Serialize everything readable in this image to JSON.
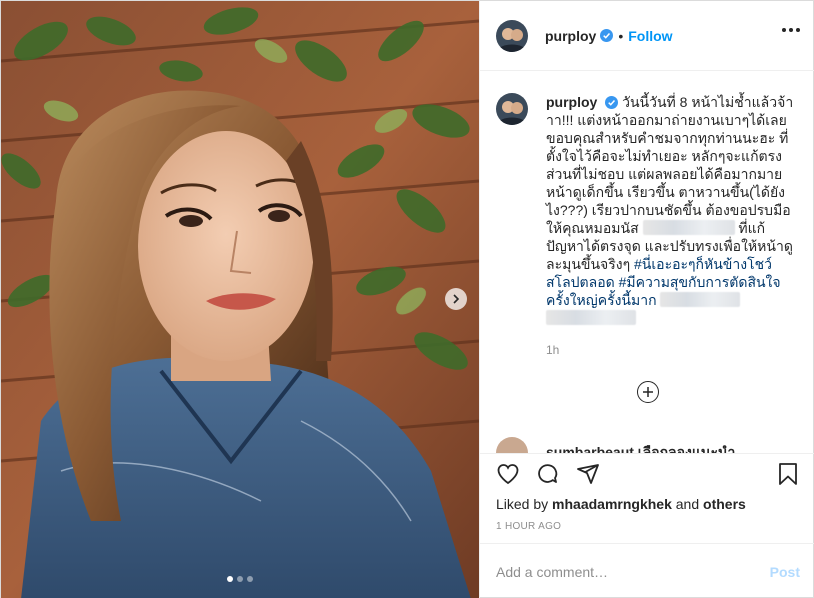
{
  "header": {
    "username": "purploy",
    "separator": "•",
    "follow_label": "Follow"
  },
  "caption": {
    "username": "purploy",
    "text_1": "วันนี้วันที่ 8 หน้าไม่ช้ำแล้วจ้าาา!!! แต่งหน้าออกมาถ่ายงานเบาๆได้เลย ขอบคุณสำหรับคำชมจากทุกท่านนะฮะ ที่ตั้งใจไว้คือจะไม่ทำเยอะ หลักๆจะแก้ตรงส่วนที่ไม่ชอบ แต่ผลพลอยได้คือมากมาย หน้าดูเด็กขึ้น เรียวขึ้น ตาหวานขึ้น(ได้ยังไง???) เรียวปากบนชัดขึ้น ต้องขอปรบมือให้คุณหมอมนัส",
    "text_2": "ที่แก้ปัญหาได้ตรงจุด และปรับทรงเพื่อให้หน้าดูละมุนขึ้นจริงๆ",
    "hashtag_1": "#นี่เอะอะๆก็หันข้างโชว์สโลปตลอด",
    "hashtag_2": "#มีความสุขกับการตัดสินใจครั้งใหญ่ครั้งนี้มาก",
    "time": "1h"
  },
  "next_comment": {
    "text": "sumbarbeaut เลือกลองแนะนำ"
  },
  "likes": {
    "prefix": "Liked by",
    "user": "mhaadamrngkhek",
    "and": "and",
    "others": "others"
  },
  "timestamp": "1 HOUR AGO",
  "comment_box": {
    "placeholder": "Add a comment…",
    "post_label": "Post"
  },
  "carousel": {
    "slide_count": 3,
    "active_index": 0
  },
  "colors": {
    "accent": "#0095f6",
    "hashtag": "#00376b",
    "verified": "#3897f0",
    "muted": "#8e8e8e"
  },
  "icons": [
    "heart-icon",
    "comment-icon",
    "share-icon",
    "bookmark-icon",
    "more-icon",
    "chevron-right-icon",
    "plus-circle-icon",
    "verified-icon"
  ]
}
